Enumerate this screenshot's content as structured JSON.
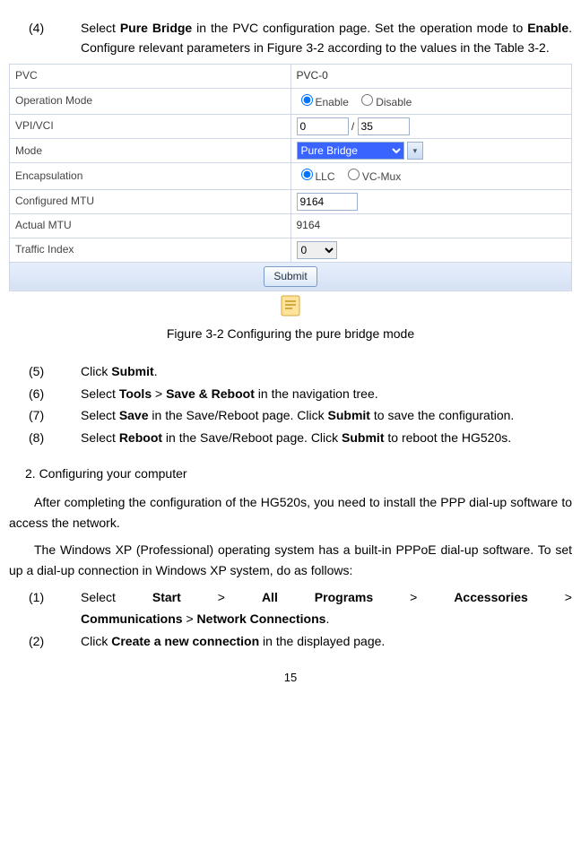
{
  "steps_top": {
    "num4": "(4)",
    "text4_a": "Select ",
    "text4_b": "Pure Bridge",
    "text4_c": " in the PVC configuration page. Set the operation mode to ",
    "text4_d": "Enable",
    "text4_e": ". Configure relevant parameters in Figure 3-2 according to the values in the Table 3-2."
  },
  "config": {
    "pvc_label": "PVC",
    "pvc_value": "PVC-0",
    "opmode_label": "Operation Mode",
    "enable": "Enable",
    "disable": "Disable",
    "vpi_label": "VPI/VCI",
    "vpi": "0",
    "vci": "35",
    "slash": " / ",
    "mode_label": "Mode",
    "mode_value": "Pure Bridge",
    "encap_label": "Encapsulation",
    "llc": "LLC",
    "vcmux": "VC-Mux",
    "cmtu_label": "Configured MTU",
    "cmtu_value": "9164",
    "amtu_label": "Actual MTU",
    "amtu_value": "9164",
    "traffic_label": "Traffic Index",
    "traffic_value": "0",
    "submit": "Submit"
  },
  "caption": "Figure 3-2 Configuring the pure bridge mode",
  "steps_mid": {
    "num5": "(5)",
    "text5_a": "Click ",
    "text5_b": "Submit",
    "text5_c": ".",
    "num6": "(6)",
    "text6_a": "Select ",
    "text6_b": "Tools",
    "text6_c": " > ",
    "text6_d": "Save & Reboot",
    "text6_e": " in the navigation tree.",
    "num7": "(7)",
    "text7_a": "Select ",
    "text7_b": "Save",
    "text7_c": " in the Save/Reboot page. Click ",
    "text7_d": "Submit",
    "text7_e": " to save the configuration.",
    "num8": "(8)",
    "text8_a": "Select ",
    "text8_b": "Reboot",
    "text8_c": " in the Save/Reboot page. Click ",
    "text8_d": "Submit",
    "text8_e": " to reboot the HG520s."
  },
  "section2": "2. Configuring your computer",
  "para1": "After completing the configuration of the HG520s, you need to install the PPP dial-up software to access the network.",
  "para2": "The Windows XP (Professional) operating system has a built-in PPPoE dial-up software. To set up a dial-up connection in Windows XP system, do as follows:",
  "steps_bottom": {
    "num1": "(1)",
    "text1_a": "Select ",
    "text1_b": "Start",
    "text1_c": " > ",
    "text1_d": "All Programs",
    "text1_e": " > ",
    "text1_f": "Accessories",
    "text1_g": " > ",
    "text1_h": "Communications",
    "text1_i": " > ",
    "text1_j": "Network Connections",
    "text1_k": ".",
    "num2": "(2)",
    "text2_a": "Click ",
    "text2_b": "Create a new connection",
    "text2_c": " in the displayed page."
  },
  "page": "15"
}
